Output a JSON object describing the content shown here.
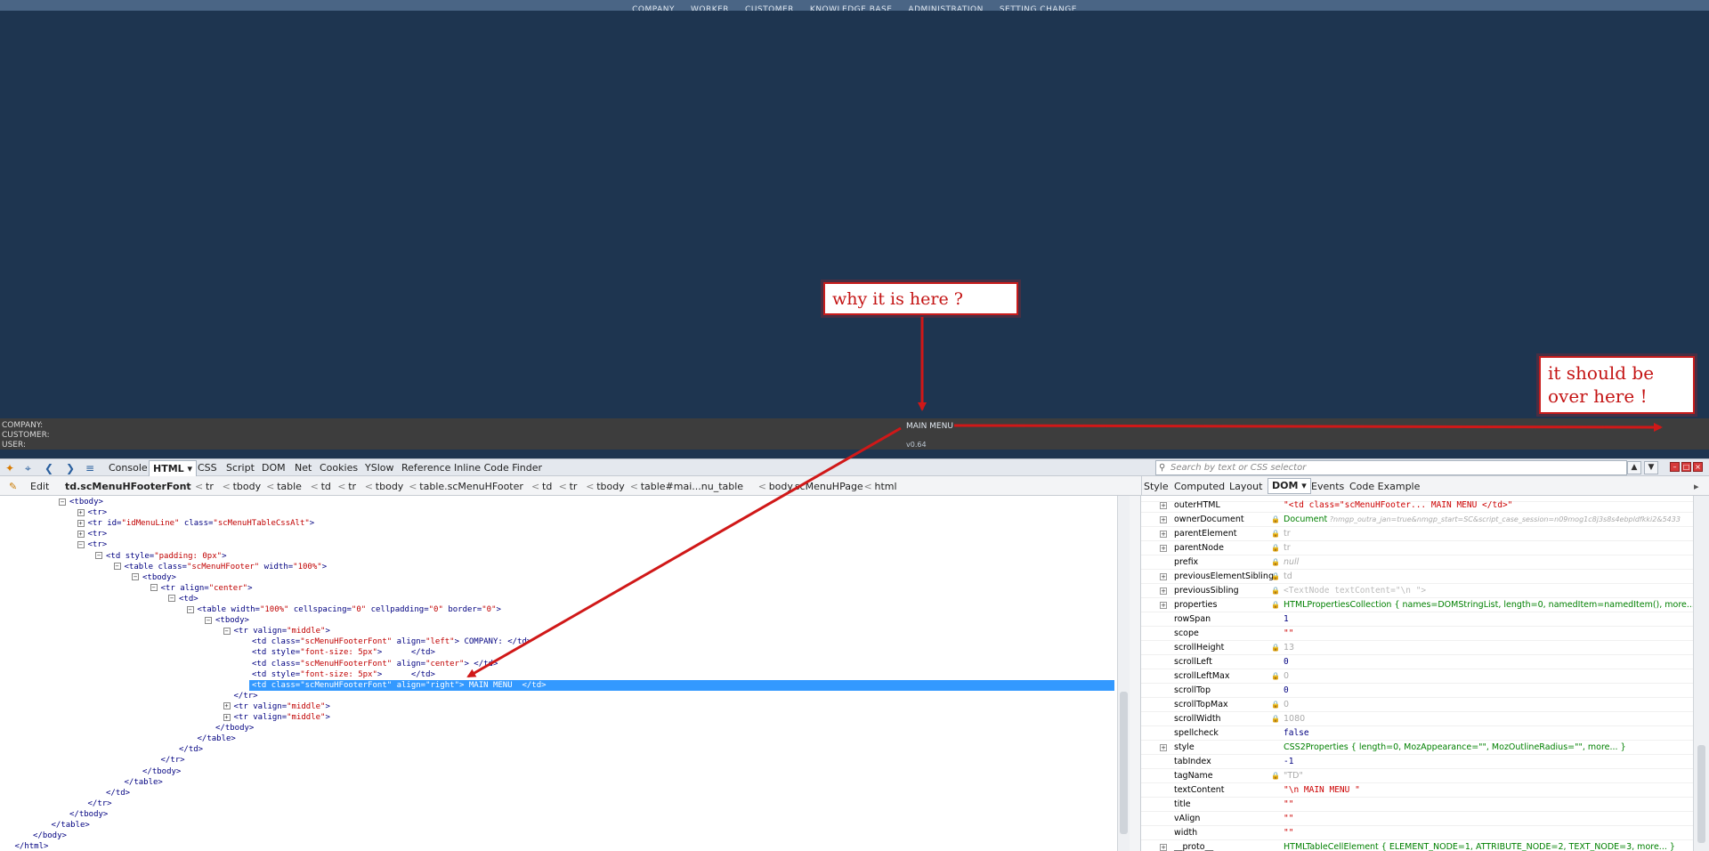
{
  "app_menu": {
    "items": [
      "COMPANY",
      "WORKER",
      "CUSTOMER",
      "KNOWLEDGE BASE",
      "ADMINISTRATION",
      "SETTING CHANGE"
    ]
  },
  "footer": {
    "company_label": "COMPANY:",
    "customer_label": "CUSTOMER:",
    "user_label": "USER:",
    "main_menu": "MAIN MENU",
    "version": "v0.64"
  },
  "annotations": {
    "note1": "why it is  here ?",
    "note2_line1": "it should be",
    "note2_line2": "over here !",
    "color": "#c81c1c"
  },
  "firebug": {
    "tabs": [
      "Console",
      "HTML",
      "CSS",
      "Script",
      "DOM",
      "Net",
      "Cookies",
      "YSlow",
      "Reference",
      "Inline Code Finder"
    ],
    "active_tab": "HTML",
    "edit_label": "Edit",
    "search_placeholder": "Search by text or CSS selector",
    "breadcrumb": [
      "td.scMenuHFooterFont",
      "tr",
      "tbody",
      "table",
      "td",
      "tr",
      "tbody",
      "table.scMenuHFooter",
      "td",
      "tr",
      "tbody",
      "table#mai...nu_table",
      "body.scMenuHPage",
      "html"
    ],
    "side_tabs": [
      "Style",
      "Computed",
      "Layout",
      "DOM",
      "Events",
      "Code Example"
    ],
    "side_active": "DOM",
    "html_lines": [
      {
        "indent": 0,
        "toggle": "⊟",
        "parts": [
          [
            "t",
            "<tbody>"
          ]
        ]
      },
      {
        "indent": 1,
        "toggle": "⊞",
        "parts": [
          [
            "t",
            "<tr>"
          ]
        ]
      },
      {
        "indent": 1,
        "toggle": "⊞",
        "parts": [
          [
            "t",
            "<tr "
          ],
          [
            "a",
            "id="
          ],
          [
            "v",
            "\"idMenuLine\""
          ],
          [
            "a",
            " class="
          ],
          [
            "v",
            "\"scMenuHTableCssAlt\""
          ],
          [
            "t",
            ">"
          ]
        ]
      },
      {
        "indent": 1,
        "toggle": "⊞",
        "parts": [
          [
            "t",
            "<tr>"
          ]
        ]
      },
      {
        "indent": 1,
        "toggle": "⊟",
        "parts": [
          [
            "t",
            "<tr>"
          ]
        ]
      },
      {
        "indent": 2,
        "toggle": "⊟",
        "parts": [
          [
            "t",
            "<td "
          ],
          [
            "a",
            "style="
          ],
          [
            "v",
            "\"padding: 0px\""
          ],
          [
            "t",
            ">"
          ]
        ]
      },
      {
        "indent": 3,
        "toggle": "⊟",
        "parts": [
          [
            "t",
            "<table "
          ],
          [
            "a",
            "class="
          ],
          [
            "v",
            "\"scMenuHFooter\""
          ],
          [
            "a",
            " width="
          ],
          [
            "v",
            "\"100%\""
          ],
          [
            "t",
            ">"
          ]
        ]
      },
      {
        "indent": 4,
        "toggle": "⊟",
        "parts": [
          [
            "t",
            "<tbody>"
          ]
        ]
      },
      {
        "indent": 5,
        "toggle": "⊟",
        "parts": [
          [
            "t",
            "<tr "
          ],
          [
            "a",
            "align="
          ],
          [
            "v",
            "\"center\""
          ],
          [
            "t",
            ">"
          ]
        ]
      },
      {
        "indent": 6,
        "toggle": "⊟",
        "parts": [
          [
            "t",
            "<td>"
          ]
        ]
      },
      {
        "indent": 7,
        "toggle": "⊟",
        "parts": [
          [
            "t",
            "<table "
          ],
          [
            "a",
            "width="
          ],
          [
            "v",
            "\"100%\""
          ],
          [
            "a",
            " cellspacing="
          ],
          [
            "v",
            "\"0\""
          ],
          [
            "a",
            " cellpadding="
          ],
          [
            "v",
            "\"0\""
          ],
          [
            "a",
            " border="
          ],
          [
            "v",
            "\"0\""
          ],
          [
            "t",
            ">"
          ]
        ]
      },
      {
        "indent": 8,
        "toggle": "⊟",
        "parts": [
          [
            "t",
            "<tbody>"
          ]
        ]
      },
      {
        "indent": 9,
        "toggle": "⊟",
        "parts": [
          [
            "t",
            "<tr "
          ],
          [
            "a",
            "valign="
          ],
          [
            "v",
            "\"middle\""
          ],
          [
            "t",
            ">"
          ]
        ]
      },
      {
        "indent": 10,
        "toggle": "",
        "parts": [
          [
            "t",
            "<td "
          ],
          [
            "a",
            "class="
          ],
          [
            "v",
            "\"scMenuHFooterFont\""
          ],
          [
            "a",
            " align="
          ],
          [
            "v",
            "\"left\""
          ],
          [
            "t",
            "> COMPANY: </td>"
          ]
        ]
      },
      {
        "indent": 10,
        "toggle": "",
        "parts": [
          [
            "t",
            "<td "
          ],
          [
            "a",
            "style="
          ],
          [
            "v",
            "\"font-size: 5px\""
          ],
          [
            "t",
            ">      </td>"
          ]
        ]
      },
      {
        "indent": 10,
        "toggle": "",
        "parts": [
          [
            "t",
            "<td "
          ],
          [
            "a",
            "class="
          ],
          [
            "v",
            "\"scMenuHFooterFont\""
          ],
          [
            "a",
            " align="
          ],
          [
            "v",
            "\"center\""
          ],
          [
            "t",
            "> </td>"
          ]
        ]
      },
      {
        "indent": 10,
        "toggle": "",
        "parts": [
          [
            "t",
            "<td "
          ],
          [
            "a",
            "style="
          ],
          [
            "v",
            "\"font-size: 5px\""
          ],
          [
            "t",
            ">      </td>"
          ]
        ]
      },
      {
        "indent": 10,
        "toggle": "",
        "sel": true,
        "parts": [
          [
            "t",
            "<td "
          ],
          [
            "a",
            "class="
          ],
          [
            "v",
            "\"scMenuHFooterFont\""
          ],
          [
            "a",
            " align="
          ],
          [
            "v",
            "\"right\""
          ],
          [
            "t",
            "> MAIN MENU  </td>"
          ]
        ]
      },
      {
        "indent": 9,
        "toggle": "",
        "parts": [
          [
            "t",
            "</tr>"
          ]
        ]
      },
      {
        "indent": 9,
        "toggle": "⊞",
        "parts": [
          [
            "t",
            "<tr "
          ],
          [
            "a",
            "valign="
          ],
          [
            "v",
            "\"middle\""
          ],
          [
            "t",
            ">"
          ]
        ]
      },
      {
        "indent": 9,
        "toggle": "⊞",
        "parts": [
          [
            "t",
            "<tr "
          ],
          [
            "a",
            "valign="
          ],
          [
            "v",
            "\"middle\""
          ],
          [
            "t",
            ">"
          ]
        ]
      },
      {
        "indent": 8,
        "toggle": "",
        "parts": [
          [
            "t",
            "</tbody>"
          ]
        ]
      },
      {
        "indent": 7,
        "toggle": "",
        "parts": [
          [
            "t",
            "</table>"
          ]
        ]
      },
      {
        "indent": 6,
        "toggle": "",
        "parts": [
          [
            "t",
            "</td>"
          ]
        ]
      },
      {
        "indent": 5,
        "toggle": "",
        "parts": [
          [
            "t",
            "</tr>"
          ]
        ]
      },
      {
        "indent": 4,
        "toggle": "",
        "parts": [
          [
            "t",
            "</tbody>"
          ]
        ]
      },
      {
        "indent": 3,
        "toggle": "",
        "parts": [
          [
            "t",
            "</table>"
          ]
        ]
      },
      {
        "indent": 2,
        "toggle": "",
        "parts": [
          [
            "t",
            "</td>"
          ]
        ]
      },
      {
        "indent": 1,
        "toggle": "",
        "parts": [
          [
            "t",
            "</tr>"
          ]
        ]
      },
      {
        "indent": 0,
        "toggle": "",
        "parts": [
          [
            "t",
            "</tbody>"
          ]
        ]
      },
      {
        "indent": -1,
        "toggle": "",
        "parts": [
          [
            "t",
            "</table>"
          ]
        ]
      },
      {
        "indent": -2,
        "toggle": "",
        "parts": [
          [
            "t",
            "</body>"
          ]
        ]
      },
      {
        "indent": -3,
        "toggle": "",
        "parts": [
          [
            "t",
            "</html>"
          ]
        ]
      }
    ],
    "dom_rows": [
      {
        "k": "outerHTML",
        "exp": true,
        "lock": false,
        "val": "\"<td class=\"scMenuHFooter... MAIN MENU          </td>\"",
        "cls": "v-str"
      },
      {
        "k": "ownerDocument",
        "exp": true,
        "lock": true,
        "val": "Document",
        "extra": " ?nmgp_outra_jan=true&nmgp_start=SC&script_case_session=n09mog1c8j3s8s4ebpldfkki2&5433",
        "cls": "v-grn"
      },
      {
        "k": "parentElement",
        "exp": true,
        "lock": true,
        "val": "tr",
        "cls": "v-gry"
      },
      {
        "k": "parentNode",
        "exp": true,
        "lock": true,
        "val": "tr",
        "cls": "v-gry"
      },
      {
        "k": "prefix",
        "exp": false,
        "lock": true,
        "val": "null",
        "cls": "v-gryi"
      },
      {
        "k": "previousElementSibling",
        "exp": true,
        "lock": true,
        "val": "td",
        "cls": "v-gry"
      },
      {
        "k": "previousSibling",
        "exp": true,
        "lock": true,
        "val": "<TextNode textContent=\"\\n         \">",
        "cls": "v-ph"
      },
      {
        "k": "properties",
        "exp": true,
        "lock": true,
        "val": "HTMLPropertiesCollection {  names=DOMStringList,  length=0,  namedItem=namedItem(),  more... }",
        "cls": "v-grn"
      },
      {
        "k": "rowSpan",
        "exp": false,
        "lock": false,
        "val": "1",
        "cls": "v-num"
      },
      {
        "k": "scope",
        "exp": false,
        "lock": false,
        "val": "\"\"",
        "cls": "v-str"
      },
      {
        "k": "scrollHeight",
        "exp": false,
        "lock": true,
        "val": "13",
        "cls": "v-gry"
      },
      {
        "k": "scrollLeft",
        "exp": false,
        "lock": false,
        "val": "0",
        "cls": "v-num"
      },
      {
        "k": "scrollLeftMax",
        "exp": false,
        "lock": true,
        "val": "0",
        "cls": "v-gry"
      },
      {
        "k": "scrollTop",
        "exp": false,
        "lock": false,
        "val": "0",
        "cls": "v-num"
      },
      {
        "k": "scrollTopMax",
        "exp": false,
        "lock": true,
        "val": "0",
        "cls": "v-gry"
      },
      {
        "k": "scrollWidth",
        "exp": false,
        "lock": true,
        "val": "1080",
        "cls": "v-gry"
      },
      {
        "k": "spellcheck",
        "exp": false,
        "lock": false,
        "val": "false",
        "cls": "v-num"
      },
      {
        "k": "style",
        "exp": true,
        "lock": false,
        "val": "CSS2Properties {  length=0,  MozAppearance=\"\",  MozOutlineRadius=\"\",  more... }",
        "cls": "v-grn"
      },
      {
        "k": "tabIndex",
        "exp": false,
        "lock": false,
        "val": "-1",
        "cls": "v-num"
      },
      {
        "k": "tagName",
        "exp": false,
        "lock": true,
        "val": "\"TD\"",
        "cls": "v-gry"
      },
      {
        "k": "textContent",
        "exp": false,
        "lock": false,
        "val": "\"\\n          MAIN MENU        \"",
        "cls": "v-str"
      },
      {
        "k": "title",
        "exp": false,
        "lock": false,
        "val": "\"\"",
        "cls": "v-str"
      },
      {
        "k": "vAlign",
        "exp": false,
        "lock": false,
        "val": "\"\"",
        "cls": "v-str"
      },
      {
        "k": "width",
        "exp": false,
        "lock": false,
        "val": "\"\"",
        "cls": "v-str"
      },
      {
        "k": "__proto__",
        "exp": true,
        "lock": false,
        "val": "HTMLTableCellElement {  ELEMENT_NODE=1,  ATTRIBUTE_NODE=2,  TEXT_NODE=3,  more... }",
        "cls": "v-grn"
      }
    ]
  }
}
